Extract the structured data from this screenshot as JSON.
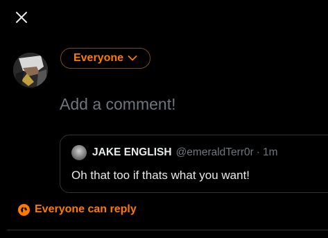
{
  "colors": {
    "accent": "#ff7a00",
    "background": "#000000",
    "text": "#e7e9ea",
    "muted": "#71767b",
    "border": "#2f3336"
  },
  "header": {
    "close_icon": "close-icon"
  },
  "composer": {
    "audience_label": "Everyone",
    "audience_icon": "chevron-down-icon",
    "placeholder": "Add a comment!",
    "value": ""
  },
  "quoted_post": {
    "display_name": "JAKE ENGLISH",
    "handle": "@emeraldTerr0r",
    "separator": "·",
    "time": "1m",
    "text": "Oh that too if thats what you want!"
  },
  "reply_setting": {
    "icon": "globe-icon",
    "label": "Everyone can reply"
  }
}
